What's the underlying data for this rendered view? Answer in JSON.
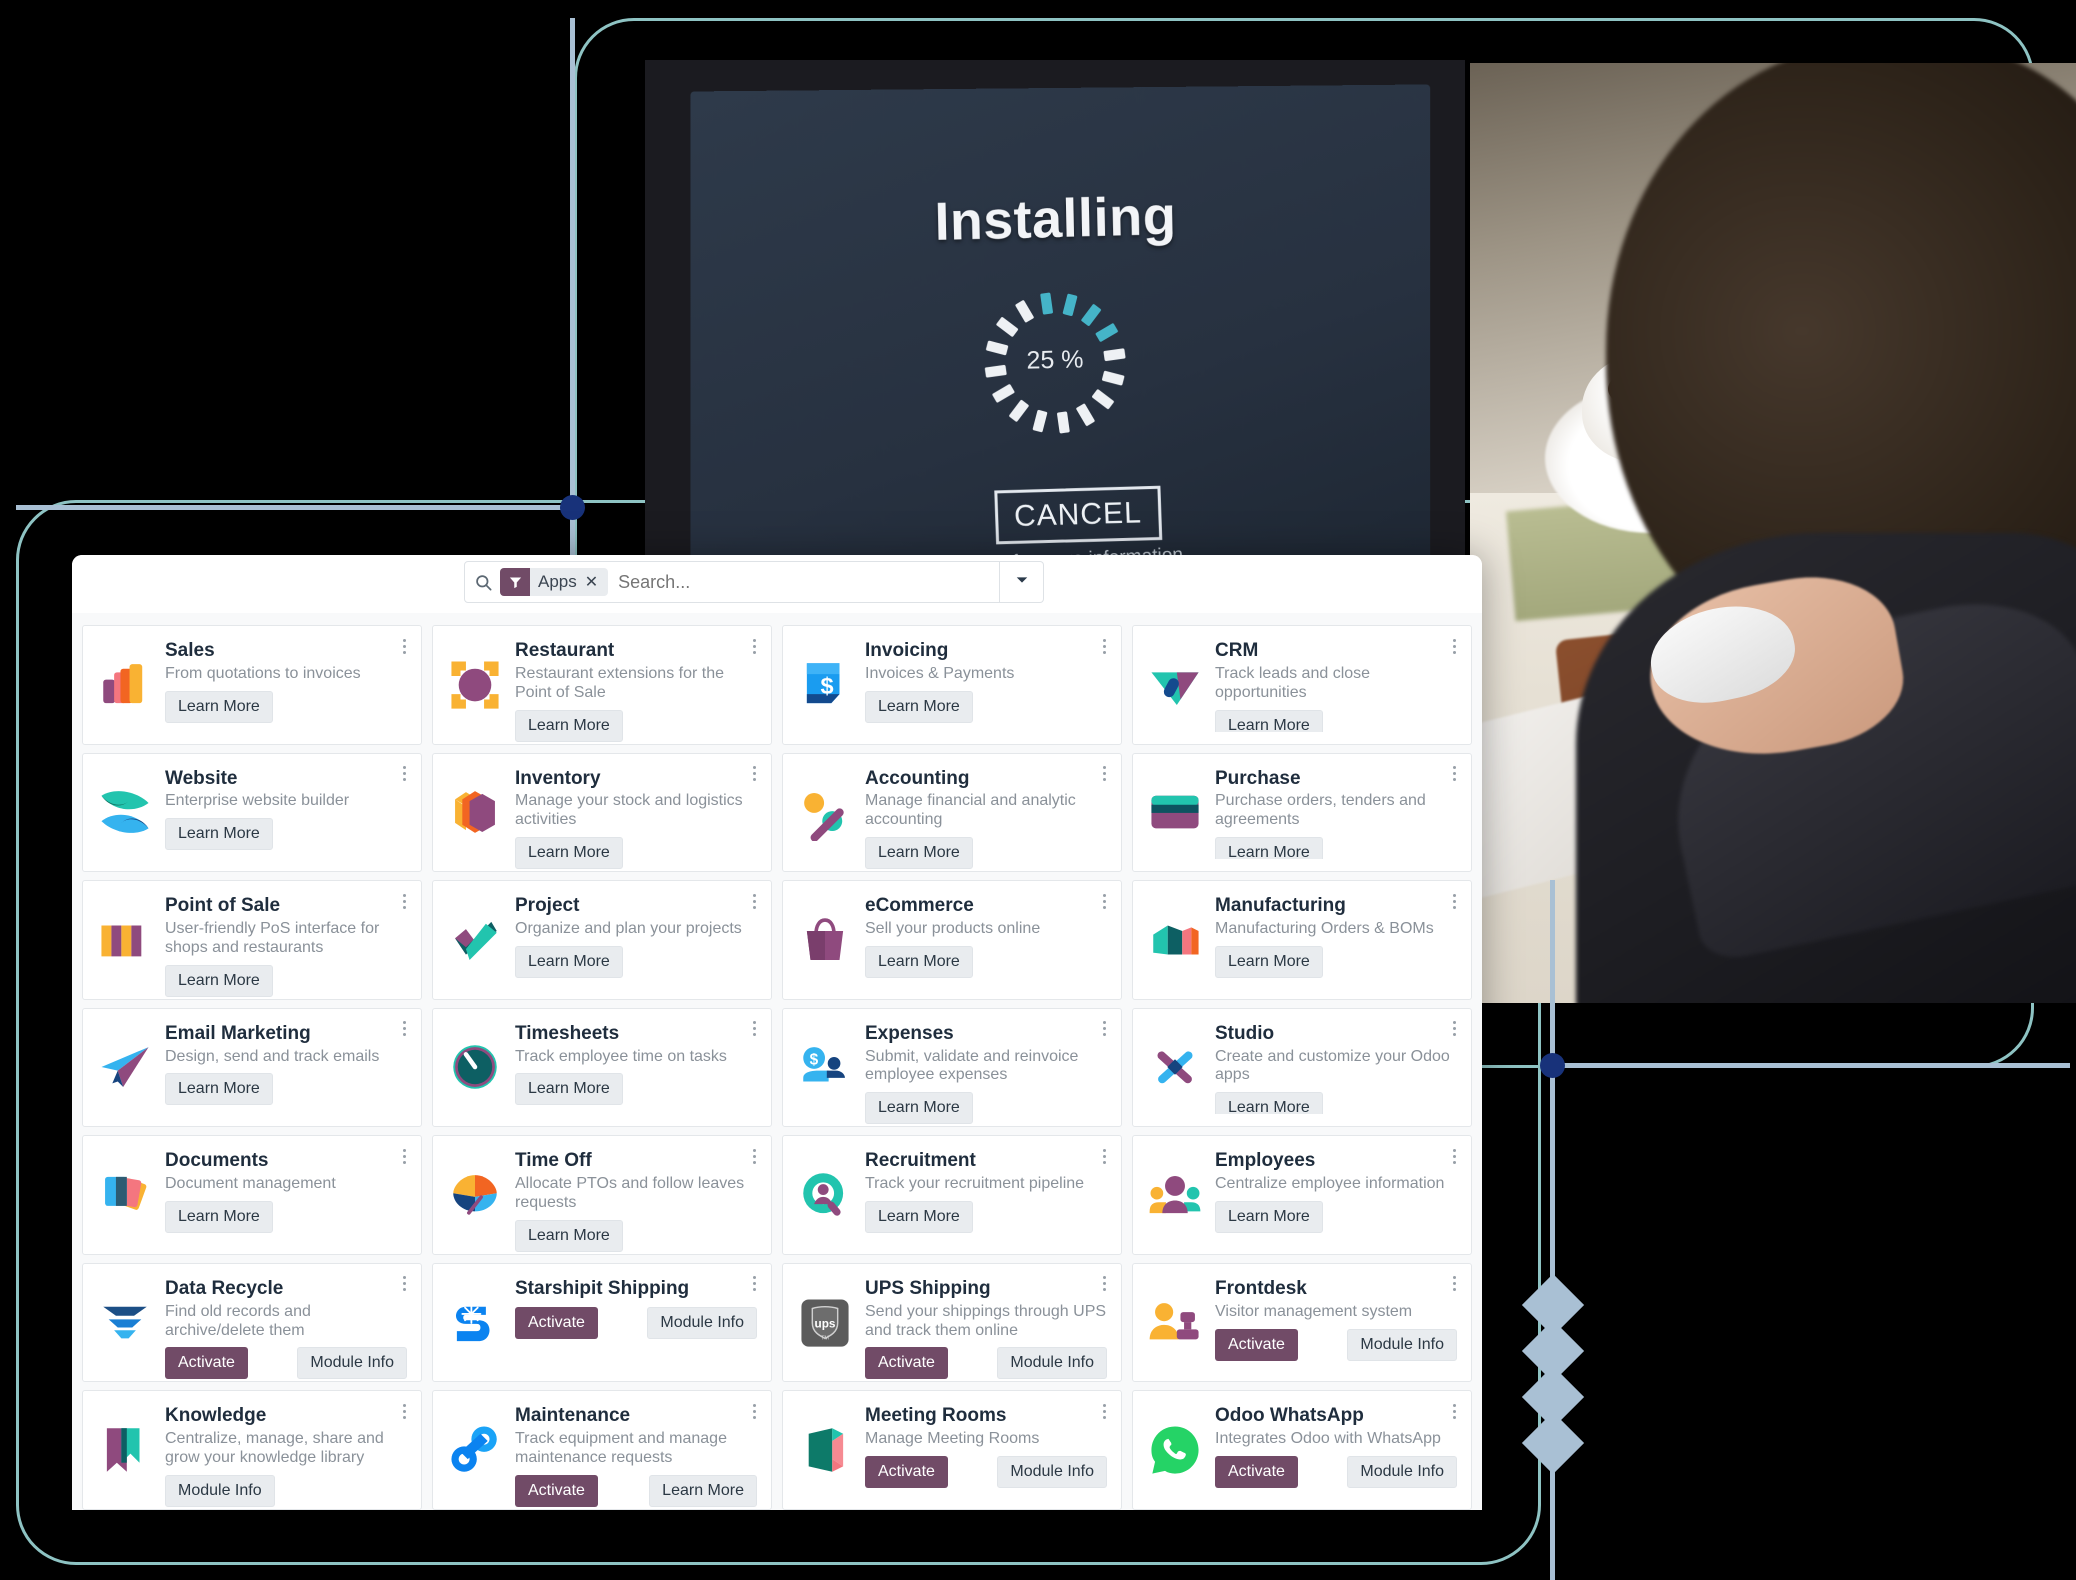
{
  "installing_screen": {
    "title": "Installing",
    "percent": "25 %",
    "cancel_label": "CANCEL",
    "more_info": "click here for more information",
    "accent_color": "#45b4c8"
  },
  "search": {
    "facet_label": "Apps",
    "facet_remove": "✕",
    "placeholder": "Search...",
    "value": "",
    "search_icon": "search-icon",
    "filter_icon": "filter-icon",
    "dropdown_icon": "chevron-down-icon",
    "facet_color": "#714b67"
  },
  "buttons": {
    "learn_more": "Learn More",
    "activate": "Activate",
    "module_info": "Module Info"
  },
  "apps": [
    {
      "name": "Sales",
      "desc": "From quotations to invoices",
      "icon": "sales-icon",
      "actions": [
        "learn_more"
      ]
    },
    {
      "name": "Restaurant",
      "desc": "Restaurant extensions for the Point of Sale",
      "icon": "restaurant-icon",
      "actions": [
        "learn_more"
      ]
    },
    {
      "name": "Invoicing",
      "desc": "Invoices & Payments",
      "icon": "invoicing-icon",
      "actions": [
        "learn_more"
      ]
    },
    {
      "name": "CRM",
      "desc": "Track leads and close opportunities",
      "icon": "crm-icon",
      "actions": [
        "learn_more"
      ]
    },
    {
      "name": "Website",
      "desc": "Enterprise website builder",
      "icon": "website-icon",
      "actions": [
        "learn_more"
      ]
    },
    {
      "name": "Inventory",
      "desc": "Manage your stock and logistics activities",
      "icon": "inventory-icon",
      "actions": [
        "learn_more"
      ]
    },
    {
      "name": "Accounting",
      "desc": "Manage financial and analytic accounting",
      "icon": "accounting-icon",
      "actions": [
        "learn_more"
      ]
    },
    {
      "name": "Purchase",
      "desc": "Purchase orders, tenders and agreements",
      "icon": "purchase-icon",
      "actions": [
        "learn_more"
      ]
    },
    {
      "name": "Point of Sale",
      "desc": "User-friendly PoS interface for shops and restaurants",
      "icon": "point-of-sale-icon",
      "actions": [
        "learn_more"
      ]
    },
    {
      "name": "Project",
      "desc": "Organize and plan your projects",
      "icon": "project-icon",
      "actions": [
        "learn_more"
      ]
    },
    {
      "name": "eCommerce",
      "desc": "Sell your products online",
      "icon": "ecommerce-icon",
      "actions": [
        "learn_more"
      ]
    },
    {
      "name": "Manufacturing",
      "desc": "Manufacturing Orders & BOMs",
      "icon": "manufacturing-icon",
      "actions": [
        "learn_more"
      ]
    },
    {
      "name": "Email Marketing",
      "desc": "Design, send and track emails",
      "icon": "email-marketing-icon",
      "actions": [
        "learn_more"
      ]
    },
    {
      "name": "Timesheets",
      "desc": "Track employee time on tasks",
      "icon": "timesheets-icon",
      "actions": [
        "learn_more"
      ]
    },
    {
      "name": "Expenses",
      "desc": "Submit, validate and reinvoice employee expenses",
      "icon": "expenses-icon",
      "actions": [
        "learn_more"
      ]
    },
    {
      "name": "Studio",
      "desc": "Create and customize your Odoo apps",
      "icon": "studio-icon",
      "actions": [
        "learn_more"
      ]
    },
    {
      "name": "Documents",
      "desc": "Document management",
      "icon": "documents-icon",
      "actions": [
        "learn_more"
      ]
    },
    {
      "name": "Time Off",
      "desc": "Allocate PTOs and follow leaves requests",
      "icon": "time-off-icon",
      "actions": [
        "learn_more"
      ]
    },
    {
      "name": "Recruitment",
      "desc": "Track your recruitment pipeline",
      "icon": "recruitment-icon",
      "actions": [
        "learn_more"
      ]
    },
    {
      "name": "Employees",
      "desc": "Centralize employee information",
      "icon": "employees-icon",
      "actions": [
        "learn_more"
      ]
    },
    {
      "name": "Data Recycle",
      "desc": "Find old records and archive/delete them",
      "icon": "data-recycle-icon",
      "actions": [
        "activate",
        "module_info"
      ]
    },
    {
      "name": "Starshipit Shipping",
      "desc": "",
      "icon": "starshipit-icon",
      "actions": [
        "activate",
        "module_info"
      ]
    },
    {
      "name": "UPS Shipping",
      "desc": "Send your shippings through UPS and track them online",
      "icon": "ups-icon",
      "actions": [
        "activate",
        "module_info"
      ]
    },
    {
      "name": "Frontdesk",
      "desc": "Visitor management system",
      "icon": "frontdesk-icon",
      "actions": [
        "activate",
        "module_info"
      ]
    },
    {
      "name": "Knowledge",
      "desc": "Centralize, manage, share and grow your knowledge library",
      "icon": "knowledge-icon",
      "actions": [
        "module_info"
      ]
    },
    {
      "name": "Maintenance",
      "desc": "Track equipment and manage maintenance requests",
      "icon": "maintenance-icon",
      "actions": [
        "activate",
        "learn_more"
      ]
    },
    {
      "name": "Meeting Rooms",
      "desc": "Manage Meeting Rooms",
      "icon": "meeting-rooms-icon",
      "actions": [
        "activate",
        "module_info"
      ]
    },
    {
      "name": "Odoo WhatsApp",
      "desc": "Integrates Odoo with WhatsApp",
      "icon": "whatsapp-icon",
      "actions": [
        "activate",
        "module_info"
      ]
    }
  ]
}
